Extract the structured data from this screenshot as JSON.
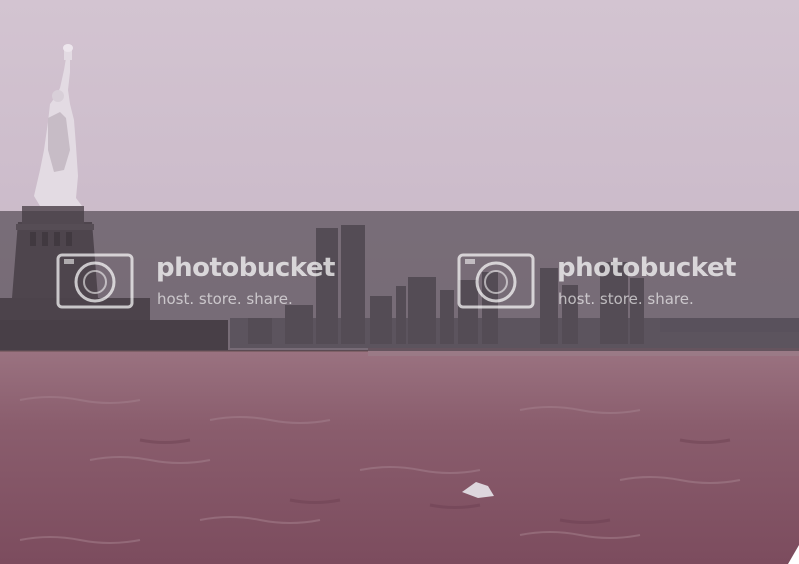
{
  "watermark": {
    "brand": "photobucket",
    "tagline": "host. store. share."
  },
  "colors": {
    "sky": "#cdbccb",
    "water": "#8a5a6a",
    "banner": "#463e46",
    "statue": "#e4dde4"
  },
  "scene": {
    "content": [
      "statue-of-liberty",
      "twin-towers-skyline",
      "harbor-water",
      "bird"
    ]
  }
}
